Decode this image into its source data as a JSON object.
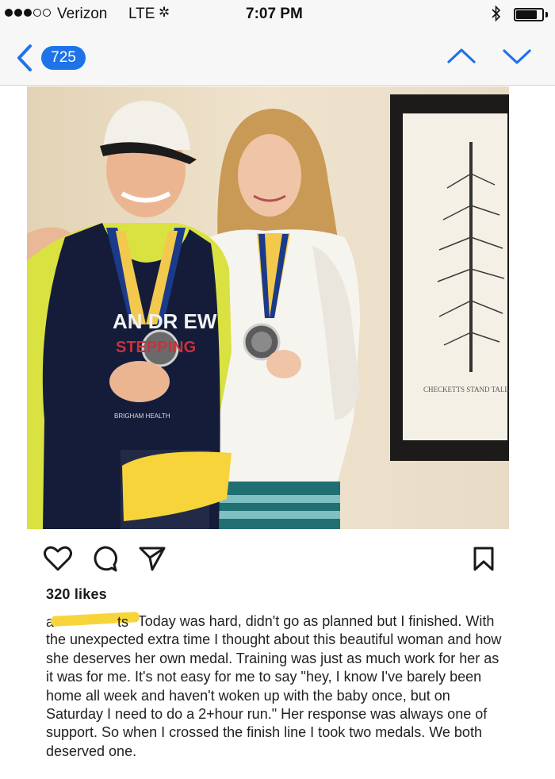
{
  "status_bar": {
    "carrier": "Verizon",
    "network": "LTE",
    "time": "7:07 PM",
    "signal_bars_filled": 3,
    "signal_bars_total": 5,
    "battery_level": 0.8,
    "icons": [
      "activity-spinner-icon",
      "bluetooth-icon",
      "battery-icon"
    ]
  },
  "nav": {
    "back_count": "725",
    "accent_color": "#1e73e8",
    "icons": [
      "back-chevron-icon",
      "up-chevron-icon",
      "down-chevron-icon"
    ]
  },
  "post": {
    "photo": {
      "jersey_text": "AN DR EW",
      "jersey_stepping": "STEPPING",
      "jersey_sponsor": "BRIGHAM HEALTH",
      "art_caption": "CHECKETTS STAND TALL"
    },
    "icons": [
      "heart-icon",
      "comment-icon",
      "share-icon",
      "bookmark-icon"
    ],
    "likes": "320 likes",
    "caption": {
      "user_start": "a",
      "user_end": "ts",
      "text": "Today was hard, didn't go as planned but I finished. With the unexpected extra time I thought about this beautiful woman and how she deserves her own medal. Training was just as much work for her as it was for me. It's not easy for me to say \"hey, I know I've barely been home all week and haven't woken up with the baby once, but on Saturday I need to do a 2+hour run.\" Her response was always one of support. So when I crossed the finish line I took two medals. We both deserved one."
    },
    "redaction_color": "#f7d43a"
  }
}
